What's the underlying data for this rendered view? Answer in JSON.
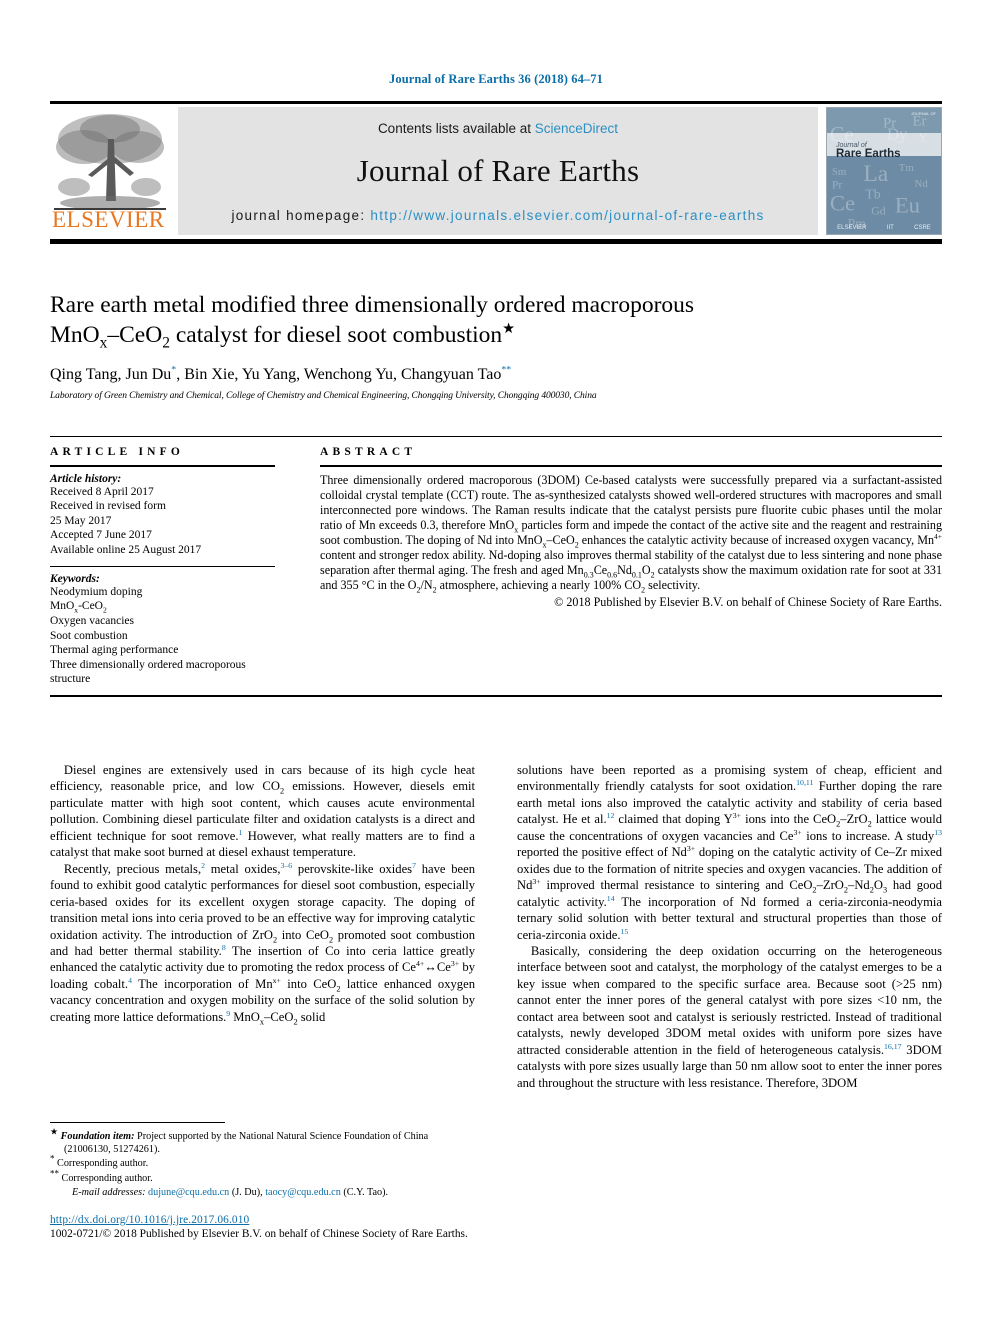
{
  "running_head": "Journal of Rare Earths 36 (2018) 64–71",
  "header": {
    "publisher_name": "ELSEVIER",
    "contents_prefix": "Contents lists available at ",
    "sciencedirect": "ScienceDirect",
    "journal_title": "Journal of Rare Earths",
    "homepage_label": "journal homepage: ",
    "homepage_url": "http://www.journals.elsevier.com/journal-of-rare-earths",
    "cover": {
      "journal_of": "Journal of",
      "rare_earths": "Rare Earths",
      "tiny_top": "JOURNAL OF",
      "footer_marks": [
        "ELSEVIER",
        "IIT",
        "CSRE"
      ],
      "bg_color": "#6d8ba4",
      "band_color": "#d7dee4"
    },
    "accent_link_color": "#2b8fc4"
  },
  "article": {
    "title_line1": "Rare earth metal modified three dimensionally ordered macroporous",
    "title_line2_pre": "MnO",
    "title_line2_sub1": "x",
    "title_line2_mid": "–CeO",
    "title_line2_sub2": "2",
    "title_line2_post": " catalyst for diesel soot combustion",
    "title_star": "★",
    "authors_plain": "Qing Tang, Jun Du",
    "authors_rest": ", Bin Xie, Yu Yang, Wenchong Yu, Changyuan Tao",
    "author_mark1": "*",
    "author_mark2": "**",
    "affiliation": "Laboratory of Green Chemistry and Chemical, College of Chemistry and Chemical Engineering, Chongqing University, Chongqing 400030, China"
  },
  "article_info": {
    "heading": "ARTICLE INFO",
    "history_label": "Article history:",
    "history_lines": [
      "Received 8 April 2017",
      "Received in revised form",
      "25 May 2017",
      "Accepted 7 June 2017",
      "Available online 25 August 2017"
    ],
    "keywords_label": "Keywords:",
    "keywords": [
      "Neodymium doping",
      "MnOx-CeO2",
      "Oxygen vacancies",
      "Soot combustion",
      "Thermal aging performance",
      "Three dimensionally ordered macroporous structure"
    ]
  },
  "abstract": {
    "heading": "ABSTRACT",
    "paragraph_part1": "Three dimensionally ordered macroporous (3DOM) Ce-based catalysts were successfully prepared via a surfactant-assisted colloidal crystal template (CCT) route. The as-synthesized catalysts showed well-ordered structures with macropores and small interconnected pore windows. The Raman results indicate that the catalyst persists pure fluorite cubic phases until the molar ratio of Mn exceeds 0.3, therefore MnO",
    "sub_x": "x",
    "paragraph_part2": " particles form and impede the contact of the active site and the reagent and restraining soot combustion. The doping of Nd into MnO",
    "paragraph_part3": "–CeO",
    "paragraph_part4": " enhances the catalytic activity because of increased oxygen vacancy, Mn",
    "sup_4plus": "4+",
    "paragraph_part5": " content and stronger redox ability. Nd-doping also improves thermal stability of the catalyst due to less sintering and none phase separation after thermal aging. The fresh and aged Mn",
    "sub_03": "0.3",
    "ce": "Ce",
    "sub_06": "0.6",
    "nd": "Nd",
    "sub_01": "0.1",
    "o": "O",
    "sub_2": "2",
    "paragraph_part6": " catalysts show the maximum oxidation rate for soot at 331 and 355 °C in the O",
    "paragraph_part7": "/N",
    "paragraph_part8": " atmosphere, achieving a nearly 100% CO",
    "paragraph_part9": " selectivity.",
    "copyright": "© 2018 Published by Elsevier B.V. on behalf of Chinese Society of Rare Earths."
  },
  "body": {
    "left_paragraphs": [
      {
        "segments": [
          {
            "t": "Diesel engines are extensively used in cars because of its high cycle heat efficiency, reasonable price, and low CO"
          },
          {
            "t": "2",
            "s": "sub"
          },
          {
            "t": " emissions. However, diesels emit particulate matter with high soot content, which causes acute environmental pollution. Combining diesel particulate filter and oxidation catalysts is a direct and efficient technique for soot remove."
          },
          {
            "t": "1",
            "s": "ref"
          },
          {
            "t": " However, what really matters are to find a catalyst that make soot burned at diesel exhaust temperature."
          }
        ]
      },
      {
        "segments": [
          {
            "t": "Recently, precious metals,"
          },
          {
            "t": "2",
            "s": "ref"
          },
          {
            "t": " metal oxides,"
          },
          {
            "t": "3–6",
            "s": "ref"
          },
          {
            "t": " perovskite-like oxides"
          },
          {
            "t": "7",
            "s": "ref"
          },
          {
            "t": " have been found to exhibit good catalytic performances for diesel soot combustion, especially ceria-based oxides for its excellent oxygen storage capacity. The doping of transition metal ions into ceria proved to be an effective way for improving catalytic oxidation activity. The introduction of ZrO"
          },
          {
            "t": "2",
            "s": "sub"
          },
          {
            "t": " into CeO"
          },
          {
            "t": "2",
            "s": "sub"
          },
          {
            "t": " promoted soot combustion and had better thermal stability."
          },
          {
            "t": "8",
            "s": "ref"
          },
          {
            "t": " The insertion of Co into ceria lattice greatly enhanced the catalytic activity due to promoting the redox process of Ce"
          },
          {
            "t": "4+",
            "s": "sup"
          },
          {
            "t": "↔Ce"
          },
          {
            "t": "3+",
            "s": "sup"
          },
          {
            "t": " by loading cobalt."
          },
          {
            "t": "4",
            "s": "ref"
          },
          {
            "t": " The incorporation of Mn"
          },
          {
            "t": "x+",
            "s": "sup"
          },
          {
            "t": " into CeO"
          },
          {
            "t": "2",
            "s": "sub"
          },
          {
            "t": " lattice enhanced oxygen vacancy concentration and oxygen mobility on the surface of the solid solution by creating more lattice deformations."
          },
          {
            "t": "9",
            "s": "ref"
          },
          {
            "t": " MnO"
          },
          {
            "t": "x",
            "s": "sub"
          },
          {
            "t": "–CeO"
          },
          {
            "t": "2",
            "s": "sub"
          },
          {
            "t": " solid"
          }
        ]
      }
    ],
    "right_paragraphs": [
      {
        "no_indent": true,
        "segments": [
          {
            "t": "solutions have been reported as a promising system of cheap, efficient and environmentally friendly catalysts for soot oxidation."
          },
          {
            "t": "10,11",
            "s": "ref"
          },
          {
            "t": " Further doping the rare earth metal ions also improved the catalytic activity and stability of ceria based catalyst. He et al."
          },
          {
            "t": "12",
            "s": "ref"
          },
          {
            "t": " claimed that doping Y"
          },
          {
            "t": "3+",
            "s": "sup"
          },
          {
            "t": " ions into the CeO"
          },
          {
            "t": "2",
            "s": "sub"
          },
          {
            "t": "–ZrO"
          },
          {
            "t": "2",
            "s": "sub"
          },
          {
            "t": " lattice would cause the concentrations of oxygen vacancies and Ce"
          },
          {
            "t": "3+",
            "s": "sup"
          },
          {
            "t": " ions to increase. A study"
          },
          {
            "t": "13",
            "s": "ref"
          },
          {
            "t": " reported the positive effect of Nd"
          },
          {
            "t": "3+",
            "s": "sup"
          },
          {
            "t": " doping on the catalytic activity of Ce–Zr mixed oxides due to the formation of nitrite species and oxygen vacancies. The addition of Nd"
          },
          {
            "t": "3+",
            "s": "sup"
          },
          {
            "t": " improved thermal resistance to sintering and CeO"
          },
          {
            "t": "2",
            "s": "sub"
          },
          {
            "t": "–ZrO"
          },
          {
            "t": "2",
            "s": "sub"
          },
          {
            "t": "–Nd"
          },
          {
            "t": "2",
            "s": "sub"
          },
          {
            "t": "O"
          },
          {
            "t": "3",
            "s": "sub"
          },
          {
            "t": " had good catalytic activity."
          },
          {
            "t": "14",
            "s": "ref"
          },
          {
            "t": " The incorporation of Nd formed a ceria-zirconia-neodymia ternary solid solution with better textural and structural properties than those of ceria-zirconia oxide."
          },
          {
            "t": "15",
            "s": "ref"
          }
        ]
      },
      {
        "segments": [
          {
            "t": "Basically, considering the deep oxidation occurring on the heterogeneous interface between soot and catalyst, the morphology of the catalyst emerges to be a key issue when compared to the specific surface area. Because soot (>25 nm) cannot enter the inner pores of the general catalyst with pore sizes <10 nm, the contact area between soot and catalyst is seriously restricted. Instead of traditional catalysts, newly developed 3DOM metal oxides with uniform pore sizes have attracted considerable attention in the field of heterogeneous catalysis."
          },
          {
            "t": "16,17",
            "s": "ref"
          },
          {
            "t": " 3DOM catalysts with pore sizes usually large than 50 nm allow soot to enter the inner pores and throughout the structure with less resistance. Therefore, 3DOM"
          }
        ]
      }
    ]
  },
  "footnotes": {
    "foundation_mark": "★",
    "foundation_label": "Foundation item:",
    "foundation_text": " Project supported by the National Natural Science Foundation of China (21006130, 51274261).",
    "corr1_mark": "*",
    "corr1_text": "Corresponding author.",
    "corr2_mark": "**",
    "corr2_text": "Corresponding author.",
    "email_label": "E-mail addresses:",
    "email1": "dujune@cqu.edu.cn",
    "email1_paren": " (J. Du), ",
    "email2": "taocy@cqu.edu.cn",
    "email2_paren": " (C.Y. Tao)."
  },
  "bottom": {
    "doi": "http://dx.doi.org/10.1016/j.jre.2017.06.010",
    "issn_copyright": "1002-0721/© 2018 Published by Elsevier B.V. on behalf of Chinese Society of Rare Earths."
  }
}
